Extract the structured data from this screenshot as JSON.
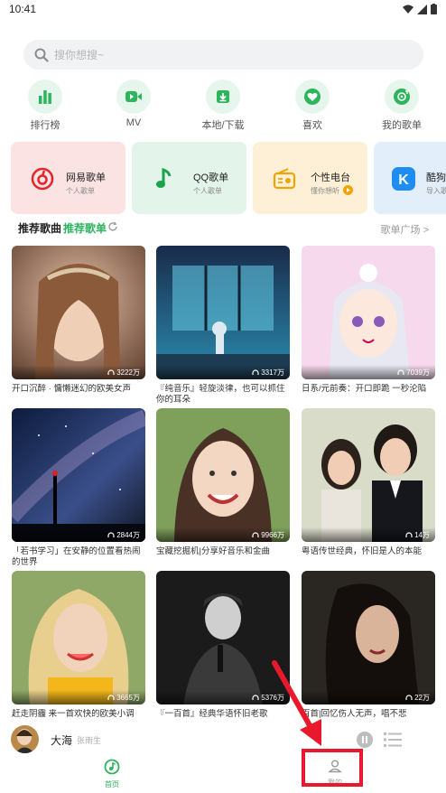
{
  "status_bar": {
    "time": "10:41"
  },
  "search": {
    "placeholder": "搜你想搜~"
  },
  "quick_nav": [
    {
      "label": "排行榜",
      "icon": "bar-chart-icon"
    },
    {
      "label": "MV",
      "icon": "video-icon"
    },
    {
      "label": "本地/下载",
      "icon": "download-icon"
    },
    {
      "label": "喜欢",
      "icon": "heart-icon"
    },
    {
      "label": "我的歌单",
      "icon": "disc-icon"
    }
  ],
  "source_cards": [
    {
      "title": "网易歌单",
      "subtitle": "个人歌单",
      "icon": "netease-icon",
      "bg": "#fbe3e4"
    },
    {
      "title": "QQ歌单",
      "subtitle": "个人歌单",
      "icon": "qq-music-icon",
      "bg": "#e3f5ea"
    },
    {
      "title": "个性电台",
      "subtitle": "懂你想听",
      "icon": "radio-icon",
      "bg": "#fdf0d7"
    },
    {
      "title": "酷狗",
      "subtitle": "导入歌",
      "icon": "kugou-icon",
      "bg": "#e3eefb"
    }
  ],
  "recommend": {
    "tab_songs": "推荐歌曲",
    "tab_playlists": "推荐歌单",
    "square_link": "歌单广场 >"
  },
  "playlists": [
    {
      "title": "开口沉醉 · 慵懒迷幻的欧美女声",
      "count": "3222万"
    },
    {
      "title": "『纯音乐』轻旋淡律，也可以抓住你的耳朵",
      "count": "3317万"
    },
    {
      "title": "日系/元前奏：开口即跪 一秒沦陷",
      "count": "7039万"
    },
    {
      "title": "「若书学习」在安静的位置看热闹的世界",
      "count": "2844万"
    },
    {
      "title": "宝藏挖掘机|分享好音乐和金曲",
      "count": "9966万"
    },
    {
      "title": "粤语传世经典，怀旧是人的本能",
      "count": "14万"
    },
    {
      "title": "赶走阴霾 来一首欢快的欧美小调",
      "count": "3665万"
    },
    {
      "title": "『一百首』经典华语怀旧老歌",
      "count": "5376万"
    },
    {
      "title": "百首|回忆伤人无声，唱不悲",
      "count": "22万"
    }
  ],
  "mini_player": {
    "title": "大海",
    "artist": "张雨生"
  },
  "bottom_nav": {
    "home": "首页",
    "profile": "我的"
  },
  "colors": {
    "accent": "#2db55d",
    "highlight": "#e8192c"
  }
}
